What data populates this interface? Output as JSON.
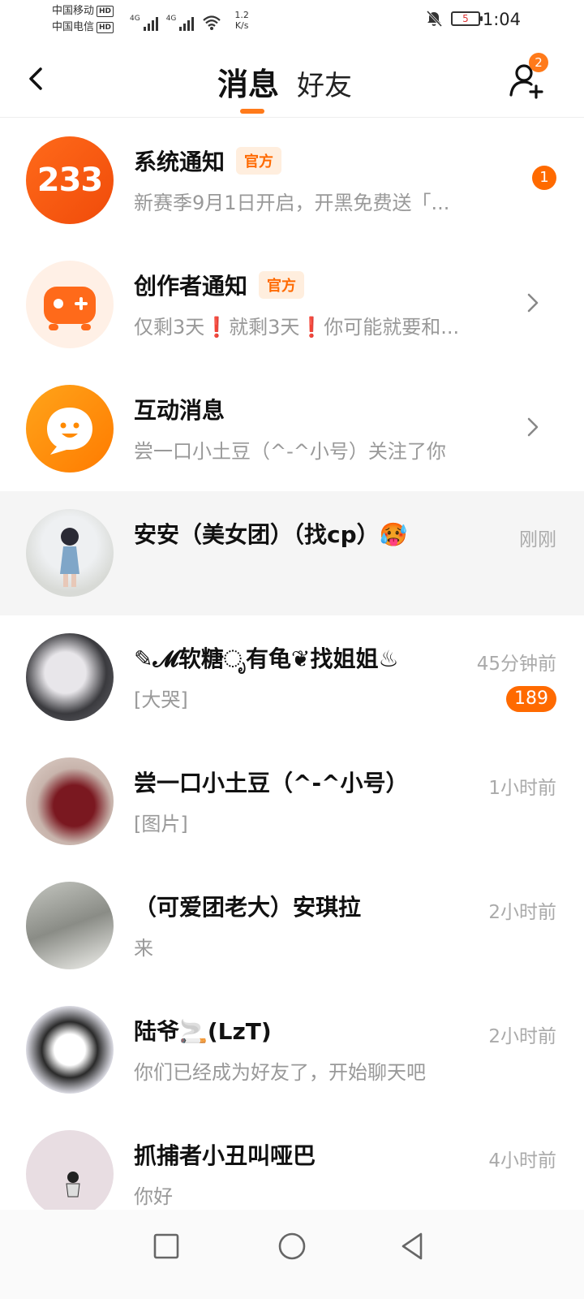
{
  "status_bar": {
    "carrier1": "中国移动",
    "carrier2": "中国电信",
    "hd_label": "HD",
    "net1": "4G",
    "net2": "4G",
    "speed_value": "1.2",
    "speed_unit": "K/s",
    "battery": "5",
    "time": "1:04"
  },
  "header": {
    "tab_messages": "消息",
    "tab_friends": "好友",
    "friend_requests": "2"
  },
  "colors": {
    "accent": "#ff7a1a",
    "tag_bg": "#ffeede"
  },
  "messages": [
    {
      "name": "系统通知",
      "tag": "官方",
      "preview": "新赛季9月1日开启，开黑免费送「...",
      "unread": "1",
      "avatar_text": "233"
    },
    {
      "name": "创作者通知",
      "tag": "官方",
      "preview": "仅剩3天❗就剩3天❗你可能就要和...",
      "icon": "gamepad-icon"
    },
    {
      "name": "互动消息",
      "preview": "尝一口小土豆（^-^小号）关注了你",
      "icon": "smile-bubble-icon"
    },
    {
      "name": "安安（美女团）（找cp）🥵",
      "time": "刚刚",
      "preview": ""
    },
    {
      "name": "✎𝓜软糖ೃ有龟❦找姐姐♨",
      "time": "45分钟前",
      "preview": "[大哭]",
      "unread": "189"
    },
    {
      "name": "尝一口小土豆（^-^小号）",
      "time": "1小时前",
      "preview": "[图片]"
    },
    {
      "name": "（可爱团老大）安琪拉",
      "time": "2小时前",
      "preview": "来"
    },
    {
      "name": "陆爷🚬(LzT)",
      "time": "2小时前",
      "preview": "你们已经成为好友了，开始聊天吧"
    },
    {
      "name": "抓捕者小丑叫哑巴",
      "time": "4小时前",
      "preview": "你好"
    }
  ]
}
